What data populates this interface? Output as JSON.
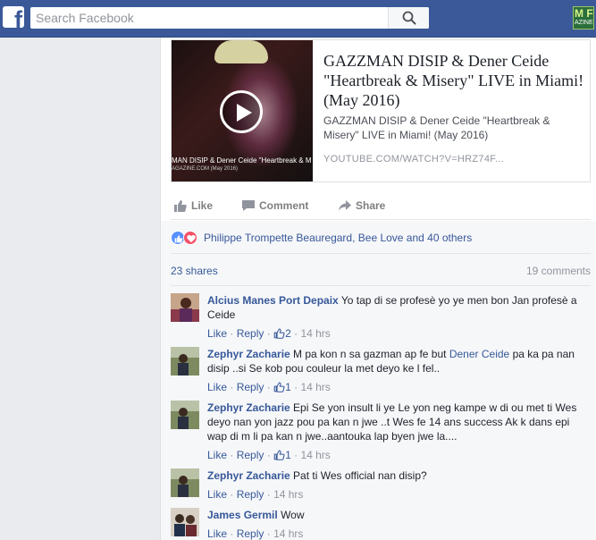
{
  "topbar": {
    "logo": "f",
    "search_placeholder": "Search Facebook",
    "search_icon": "magnifier-icon",
    "right_logo_top": "M F",
    "right_logo_bottom": "AZINE"
  },
  "shared_link": {
    "thumb_caption": "MAN DISIP & Dener Ceide \"Heartbreak & M",
    "thumb_caption_small": "AGAZINE.COM (May 2016)",
    "title": "GAZZMAN DISIP & Dener Ceide \"Heartbreak & Misery\" LIVE in Miami! (May 2016)",
    "description": "GAZZMAN DISIP & Dener Ceide \"Heartbreak & Misery\" LIVE in Miami! (May 2016)",
    "url": "YOUTUBE.COM/WATCH?V=HRZ74F..."
  },
  "actions": {
    "like": "Like",
    "comment": "Comment",
    "share": "Share"
  },
  "reactions": {
    "names": "Philippe Trompette Beauregard, Bee Love and 40 others",
    "shares": "23 shares",
    "comments": "19 comments"
  },
  "comments": [
    {
      "name": "Alcius Manes Port Depaix",
      "text": "Yo tap di se profesè yo ye men bon Jan profesè a Ceide",
      "like": "Like",
      "reply": "Reply",
      "likes": "2",
      "time": "14 hrs"
    },
    {
      "name": "Zephyr Zacharie",
      "text_before": "M pa kon n sa gazman ap fe but",
      "mention": "Dener Ceide",
      "text_after": "pa ka pa nan disip ..si Se kob pou couleur la met deyo ke l fel..",
      "like": "Like",
      "reply": "Reply",
      "likes": "1",
      "time": "14 hrs"
    },
    {
      "name": "Zephyr Zacharie",
      "text": "Epi Se yon insult li ye Le yon neg kampe w di ou met ti Wes deyo nan yon jazz pou pa kan n jwe ..t Wes fe 14 ans success Ak k dans epi wap di m li pa kan n jwe..aantouka lap byen jwe la....",
      "like": "Like",
      "reply": "Reply",
      "likes": "1",
      "time": "14 hrs"
    },
    {
      "name": "Zephyr Zacharie",
      "text": "Pat ti Wes official nan disip?",
      "like": "Like",
      "reply": "Reply",
      "time": "14 hrs"
    },
    {
      "name": "James Germil",
      "text": "Wow",
      "like": "Like",
      "reply": "Reply",
      "time": "14 hrs"
    }
  ],
  "separators": {
    "dot": "·"
  },
  "colors": {
    "brand_blue": "#3b5998",
    "link_blue": "#365899",
    "like_reaction": "#5890ff",
    "love_reaction": "#f25268"
  }
}
